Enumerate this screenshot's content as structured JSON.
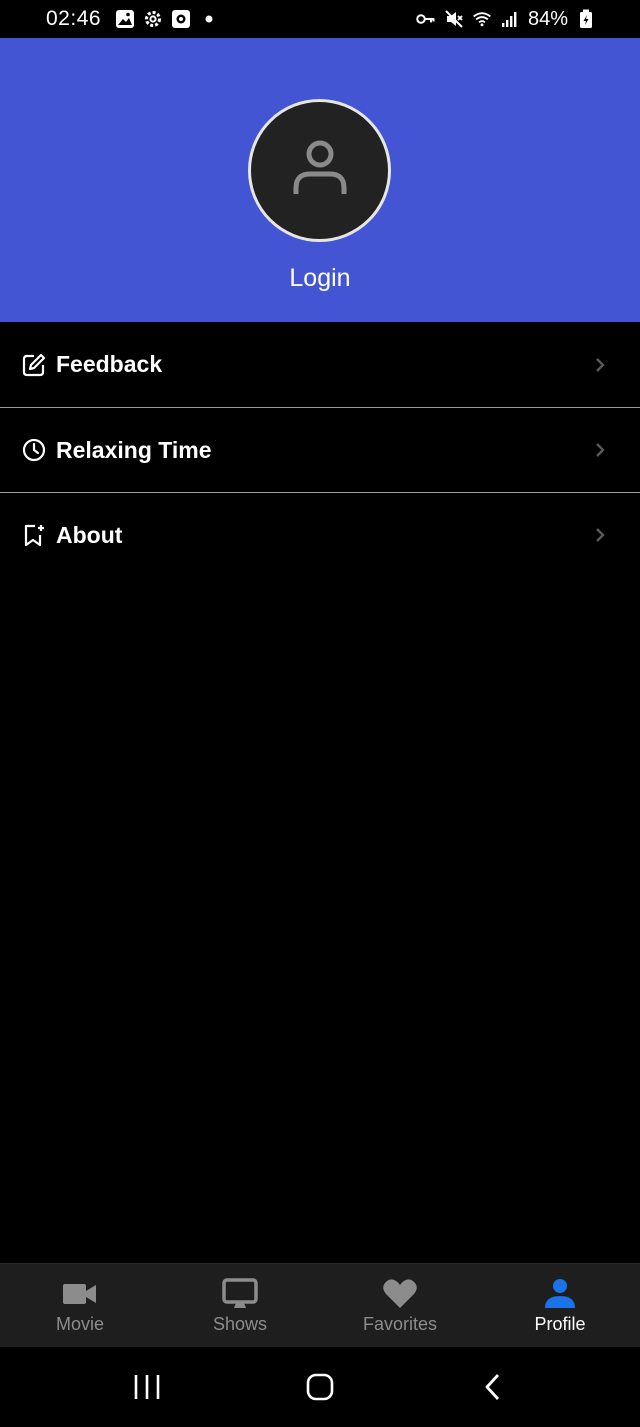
{
  "status_bar": {
    "time": "02:46",
    "battery": "84%",
    "left_icons": [
      "image-icon",
      "settings-icon",
      "app-icon",
      "dot-icon"
    ],
    "right_icons": [
      "key-icon",
      "mute-icon",
      "wifi-icon",
      "signal-icon",
      "battery-icon"
    ]
  },
  "header": {
    "background": "#4455d3",
    "avatar_icon": "user-icon",
    "login_label": "Login"
  },
  "menu": {
    "items": [
      {
        "label": "Feedback",
        "icon": "edit-icon"
      },
      {
        "label": "Relaxing Time",
        "icon": "clock-icon"
      },
      {
        "label": "About",
        "icon": "bookmark-icon"
      }
    ]
  },
  "bottom_nav": {
    "items": [
      {
        "label": "Movie",
        "icon": "video-camera-icon",
        "active": false
      },
      {
        "label": "Shows",
        "icon": "monitor-icon",
        "active": false
      },
      {
        "label": "Favorites",
        "icon": "heart-icon",
        "active": false
      },
      {
        "label": "Profile",
        "icon": "person-icon",
        "active": true
      }
    ],
    "active_color": "#1a73e8",
    "inactive_color": "#8c8c8c"
  },
  "system_nav": {
    "buttons": [
      "recents-button",
      "home-button",
      "back-button"
    ]
  }
}
